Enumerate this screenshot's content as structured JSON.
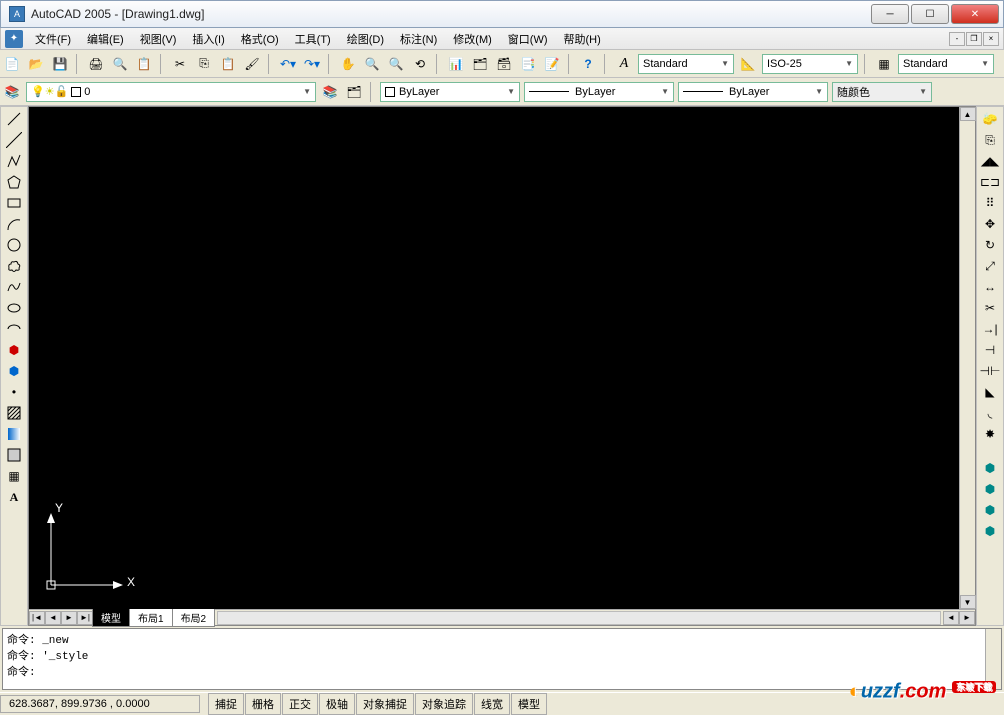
{
  "title": "AutoCAD 2005 - [Drawing1.dwg]",
  "menu": [
    "文件(F)",
    "编辑(E)",
    "视图(V)",
    "插入(I)",
    "格式(O)",
    "工具(T)",
    "绘图(D)",
    "标注(N)",
    "修改(M)",
    "窗口(W)",
    "帮助(H)"
  ],
  "text_style": {
    "label": "Standard"
  },
  "dim_style": {
    "label": "ISO-25"
  },
  "table_style": {
    "label": "Standard"
  },
  "layer": {
    "current": "0"
  },
  "props": {
    "color_label": "ByLayer",
    "linetype_label": "ByLayer",
    "lineweight_label": "ByLayer",
    "plotstyle_label": "随颜色"
  },
  "tabs": {
    "model": "模型",
    "layout1": "布局1",
    "layout2": "布局2"
  },
  "ucs": {
    "x": "X",
    "y": "Y"
  },
  "cmd": {
    "line1": "命令: _new",
    "line2": "命令: '_style",
    "prompt": "命令:"
  },
  "status": {
    "coords": "628.3687, 899.9736 , 0.0000",
    "snap": "捕捉",
    "grid": "栅格",
    "ortho": "正交",
    "polar": "极轴",
    "osnap": "对象捕捉",
    "otrack": "对象追踪",
    "lwt": "线宽",
    "model": "模型"
  },
  "watermark": {
    "text": "uzzf",
    "suffix": ".com",
    "tag": "东坡下载"
  }
}
